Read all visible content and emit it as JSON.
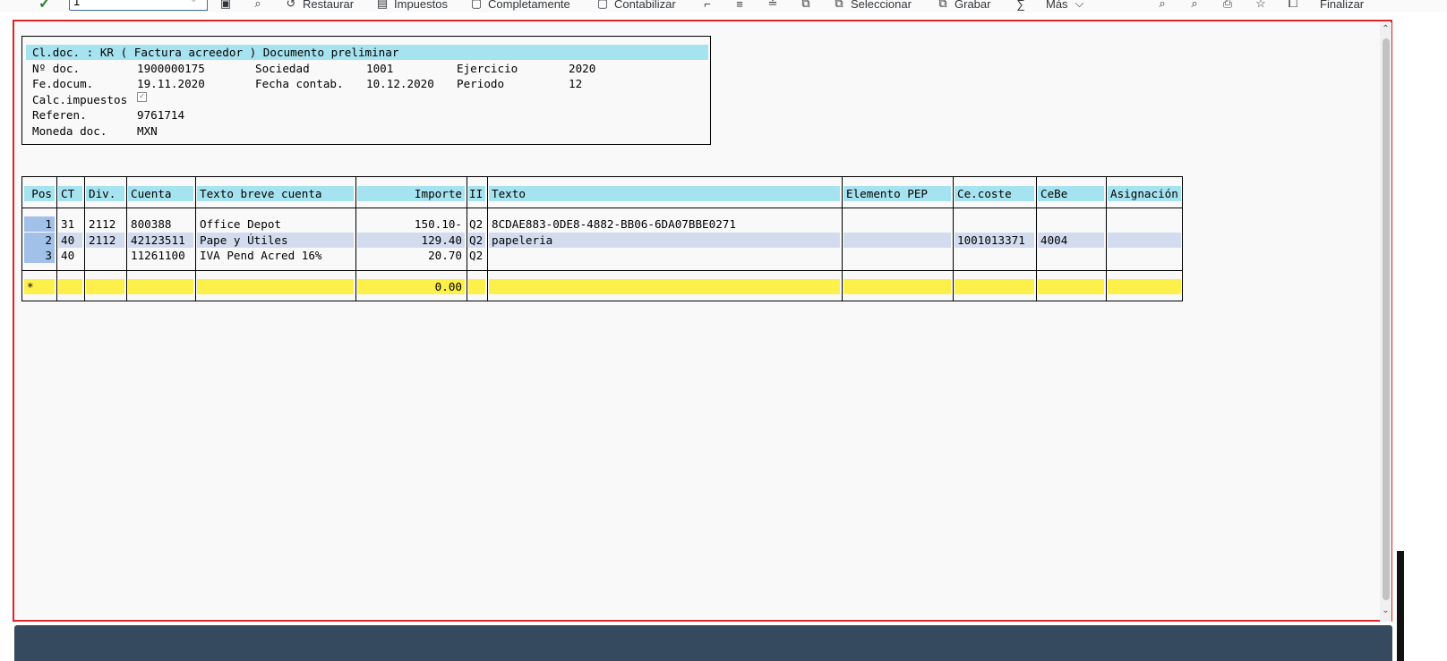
{
  "toolbar": {
    "input_value": "1",
    "items": [
      {
        "label": "Restaurar",
        "icon": "restore-icon"
      },
      {
        "label": "Impuestos",
        "icon": "tax-icon"
      },
      {
        "label": "Completamente",
        "icon": "complete-icon"
      },
      {
        "label": "Contabilizar",
        "icon": "post-icon"
      },
      {
        "label": "Seleccionar",
        "icon": "select-icon"
      },
      {
        "label": "Grabar",
        "icon": "save-icon"
      },
      {
        "label": "Más",
        "icon": "chevron-down-icon"
      },
      {
        "label": "Finalizar",
        "icon": "exit-icon"
      }
    ],
    "sigma": "∑"
  },
  "header": {
    "title": "Cl.doc. : KR ( Factura acreedor ) Documento preliminar",
    "doc_no_label": "Nº doc.",
    "doc_no": "1900000175",
    "company_label": "Sociedad",
    "company": "1001",
    "fiscal_year_label": "Ejercicio",
    "fiscal_year": "2020",
    "doc_date_label": "Fe.docum.",
    "doc_date": "19.11.2020",
    "posting_date_label": "Fecha contab.",
    "posting_date": "10.12.2020",
    "period_label": "Periodo",
    "period": "12",
    "calc_tax_label": "Calc.impuestos",
    "calc_tax_checked": true,
    "reference_label": "Referen.",
    "reference": "9761714",
    "currency_label": "Moneda doc.",
    "currency": "MXN"
  },
  "table": {
    "columns": {
      "pos": "Pos",
      "ct": "CT",
      "div": "Div.",
      "cuenta": "Cuenta",
      "texto_breve": "Texto breve cuenta",
      "importe": "Importe",
      "ii": "II",
      "texto": "Texto",
      "pep": "Elemento PEP",
      "ce_coste": "Ce.coste",
      "cebe": "CeBe",
      "asignacion": "Asignación"
    },
    "rows": [
      {
        "pos": "1",
        "ct": "31",
        "div": "2112",
        "cuenta": "800388",
        "texto_breve": "Office Depot",
        "importe": "150.10-",
        "ii": "Q2",
        "texto": "8CDAE883-0DE8-4882-BB06-6DA07BBE0271",
        "pep": "",
        "ce_coste": "",
        "cebe": "",
        "asignacion": ""
      },
      {
        "pos": "2",
        "ct": "40",
        "div": "2112",
        "cuenta": "42123511",
        "texto_breve": "Pape y Útiles",
        "importe": "129.40",
        "ii": "Q2",
        "texto": "papeleria",
        "pep": "",
        "ce_coste": "1001013371",
        "cebe": "4004",
        "asignacion": ""
      },
      {
        "pos": "3",
        "ct": "40",
        "div": "",
        "cuenta": "11261100",
        "texto_breve": "IVA Pend Acred 16%",
        "importe": "20.70",
        "ii": "Q2",
        "texto": "",
        "pep": "",
        "ce_coste": "",
        "cebe": "",
        "asignacion": ""
      }
    ],
    "total": {
      "marker": "*",
      "importe": "0.00"
    }
  }
}
